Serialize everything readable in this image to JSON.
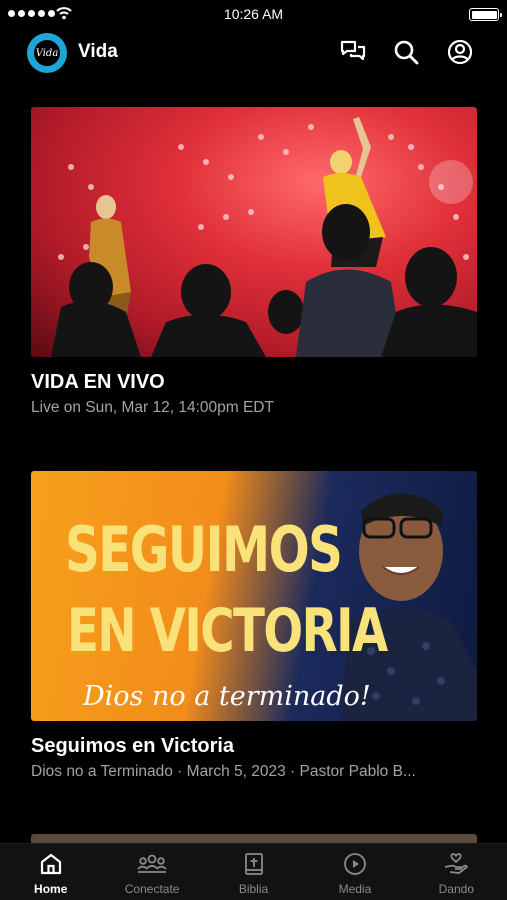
{
  "status_bar": {
    "time": "10:26 AM"
  },
  "header": {
    "logo_text": "Vida",
    "title": "Vida",
    "icons": [
      "chat-icon",
      "search-icon",
      "profile-icon"
    ]
  },
  "cards": [
    {
      "title": "VIDA EN VIVO",
      "subtitle": "Live on Sun, Mar 12, 14:00pm EDT"
    },
    {
      "title": "Seguimos en Victoria",
      "subtitle": "Dios no a Terminado · March 5, 2023 · Pastor Pablo B...",
      "thumb_line1": "SEGUIMOS",
      "thumb_line2": "EN VICTORIA",
      "thumb_tagline": "Dios no a terminado!"
    }
  ],
  "tab_bar": {
    "items": [
      {
        "label": "Home",
        "icon": "home-icon",
        "active": true
      },
      {
        "label": "Conectate",
        "icon": "group-icon",
        "active": false
      },
      {
        "label": "Biblia",
        "icon": "bible-icon",
        "active": false
      },
      {
        "label": "Media",
        "icon": "play-icon",
        "active": false
      },
      {
        "label": "Dando",
        "icon": "giving-icon",
        "active": false
      }
    ]
  },
  "colors": {
    "accent": "#1fa6d8",
    "background": "#000000",
    "subtitle": "#a3a3a3"
  }
}
